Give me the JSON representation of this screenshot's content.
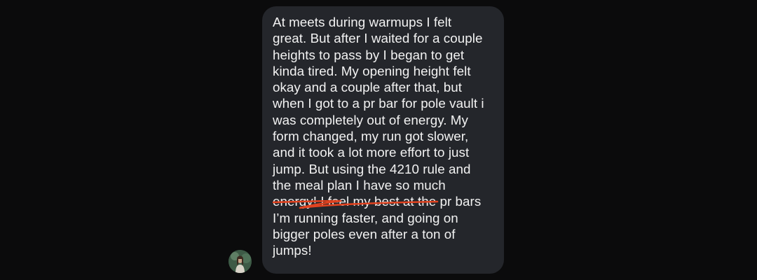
{
  "message": {
    "lines": [
      "At meets during warmups I felt",
      "great. But after I waited for a couple",
      "heights to pass by I began to get",
      "kinda tired. My opening height felt",
      "okay and a couple after that, but",
      "when I got to a pr bar for pole vault i",
      "was completely out of energy. My",
      "form changed, my run got slower,",
      "and it took a lot more effort to just",
      "jump. But using the 4210 rule and",
      "the meal plan I have so much",
      "energy! I feel my best at the pr bars",
      "I’m running faster, and going on",
      "bigger poles even after a ton of",
      "jumps!"
    ]
  },
  "colors": {
    "background": "#0b0b0c",
    "bubble": "#24262b",
    "text": "#f2f2f2",
    "annotation": "#e0421f"
  },
  "annotation": {
    "type": "hand-drawn underline",
    "under_line_index": 10
  },
  "avatar": {
    "icon": "profile-photo-avatar"
  }
}
